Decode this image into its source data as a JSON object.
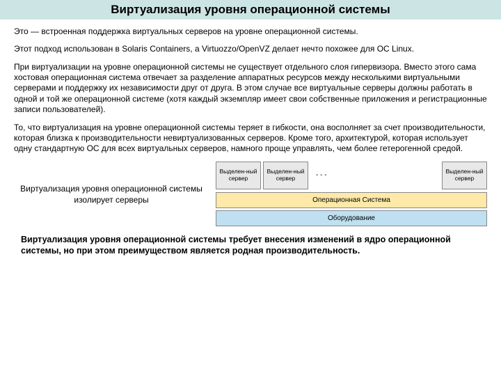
{
  "title": "Виртуализация уровня операционной системы",
  "paragraphs": {
    "p1": "Это — встроенная поддержка виртуальных серверов на уровне операционной системы.",
    "p2": "Этот подход использован в Solaris Containers, а Virtuozzo/OpenVZ делает нечто похожее для ОС Linux.",
    "p3": "При виртуализации на уровне операционной системы не существует отдельного слоя гипервизора. Вместо этого сама хостовая операционная система отвечает за разделение аппаратных ресурсов между несколькими виртуальными серверами и поддержку их независимости друг от друга. В этом случае все виртуальные серверы должны работать в одной и той же операционной системе (хотя каждый экземпляр имеет свои собственные приложения и регистрационные записи пользователей).",
    "p4": "То, что виртуализация на уровне операционной системы теряет в гибкости, она восполняет за счет производительности, которая близка к производительности невиртуализованных серверов. Кроме того, архитектурой, которая использует одну стандартную ОС для всех виртуальных серверов, намного проще управлять, чем более гетерогенной средой."
  },
  "caption": {
    "line1": "Виртуализация уровня операционной системы",
    "line2": "изолирует серверы"
  },
  "diagram": {
    "srv1": "Выделен-ный сервер",
    "srv2": "Выделен-ный сервер",
    "dots": "- - -",
    "srv3": "Выделен-ный сервер",
    "os": "Операционная Система",
    "hw": "Оборудование"
  },
  "conclusion": "Виртуализация уровня операционной системы требует внесения изменений в ядро операционной системы, но при этом преимуществом является родная производительность."
}
